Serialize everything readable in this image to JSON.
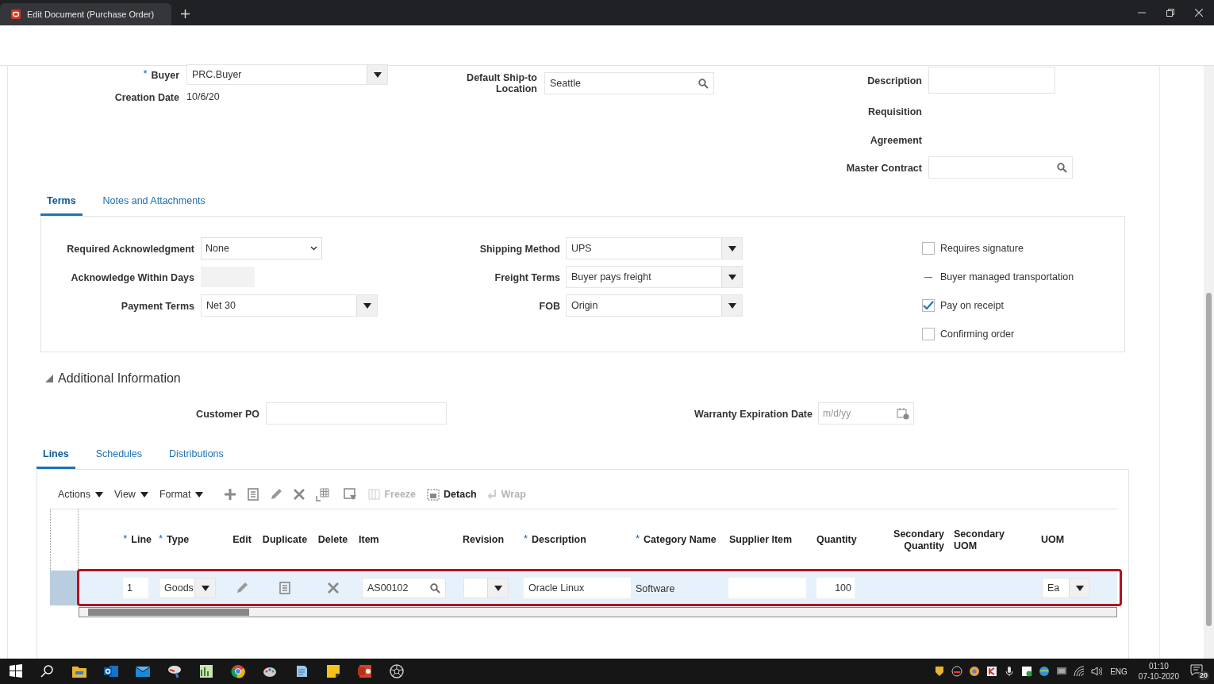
{
  "browser": {
    "tab_title": "Edit Document (Purchase Order)"
  },
  "required_mark": "*",
  "header": {
    "buyer": {
      "label": "Buyer",
      "value": "PRC.Buyer",
      "required": true
    },
    "creation_date": {
      "label": "Creation Date",
      "value": "10/6/20"
    },
    "ship_to": {
      "label": "Default Ship-to Location",
      "value": "Seattle"
    },
    "description": {
      "label": "Description"
    },
    "requisition": {
      "label": "Requisition"
    },
    "agreement": {
      "label": "Agreement"
    },
    "master_contract": {
      "label": "Master Contract"
    }
  },
  "terms_tabs": [
    {
      "label": "Terms",
      "selected": true
    },
    {
      "label": "Notes and Attachments",
      "selected": false
    }
  ],
  "terms": {
    "required_acknowledgment": {
      "label": "Required Acknowledgment",
      "value": "None"
    },
    "acknowledge_within_days": {
      "label": "Acknowledge Within Days"
    },
    "payment_terms": {
      "label": "Payment Terms",
      "value": "Net 30"
    },
    "shipping_method": {
      "label": "Shipping Method",
      "value": "UPS"
    },
    "freight_terms": {
      "label": "Freight Terms",
      "value": "Buyer pays freight"
    },
    "fob": {
      "label": "FOB",
      "value": "Origin"
    },
    "options": [
      {
        "label": "Requires signature",
        "kind": "checkbox",
        "checked": false
      },
      {
        "label": "Buyer managed transportation",
        "kind": "readonly",
        "checked": false
      },
      {
        "label": "Pay on receipt",
        "kind": "checkbox",
        "checked": true
      },
      {
        "label": "Confirming order",
        "kind": "checkbox",
        "checked": false
      }
    ]
  },
  "additional_information": {
    "title": "Additional Information",
    "expanded": true,
    "customer_po": {
      "label": "Customer PO"
    },
    "warranty_expiration_date": {
      "label": "Warranty Expiration Date",
      "placeholder": "m/d/yy"
    }
  },
  "line_tabs": [
    {
      "label": "Lines",
      "selected": true
    },
    {
      "label": "Schedules",
      "selected": false
    },
    {
      "label": "Distributions",
      "selected": false
    }
  ],
  "toolbar": {
    "menus": [
      {
        "label": "Actions"
      },
      {
        "label": "View"
      },
      {
        "label": "Format"
      }
    ],
    "buttons": [
      {
        "label": "Freeze",
        "kind": "freeze",
        "disabled": true
      },
      {
        "label": "Detach",
        "kind": "detach",
        "disabled": false
      },
      {
        "label": "Wrap",
        "kind": "wrap",
        "disabled": true
      }
    ]
  },
  "table": {
    "columns": [
      {
        "label": "Line",
        "required": true
      },
      {
        "label": "Type",
        "required": true
      },
      {
        "label": "Edit",
        "required": false
      },
      {
        "label": "Duplicate",
        "required": false
      },
      {
        "label": "Delete",
        "required": false
      },
      {
        "label": "Item",
        "required": false
      },
      {
        "label": "Revision",
        "required": false
      },
      {
        "label": "Description",
        "required": true
      },
      {
        "label": "Category Name",
        "required": true
      },
      {
        "label": "Supplier Item",
        "required": false
      },
      {
        "label": "Quantity",
        "required": false
      },
      {
        "label": "Secondary Quantity",
        "required": false
      },
      {
        "label": "Secondary UOM",
        "required": false
      },
      {
        "label": "UOM",
        "required": false
      }
    ],
    "rows": [
      {
        "selected": true,
        "highlighted": true,
        "line": "1",
        "type": "Goods",
        "item": "AS00102",
        "description": "Oracle Linux",
        "category_name": "Software",
        "quantity": "100",
        "uom": "Ea"
      }
    ]
  },
  "taskbar": {
    "language": "ENG",
    "time": "01:10",
    "date": "07-10-2020",
    "notifications": "20"
  }
}
